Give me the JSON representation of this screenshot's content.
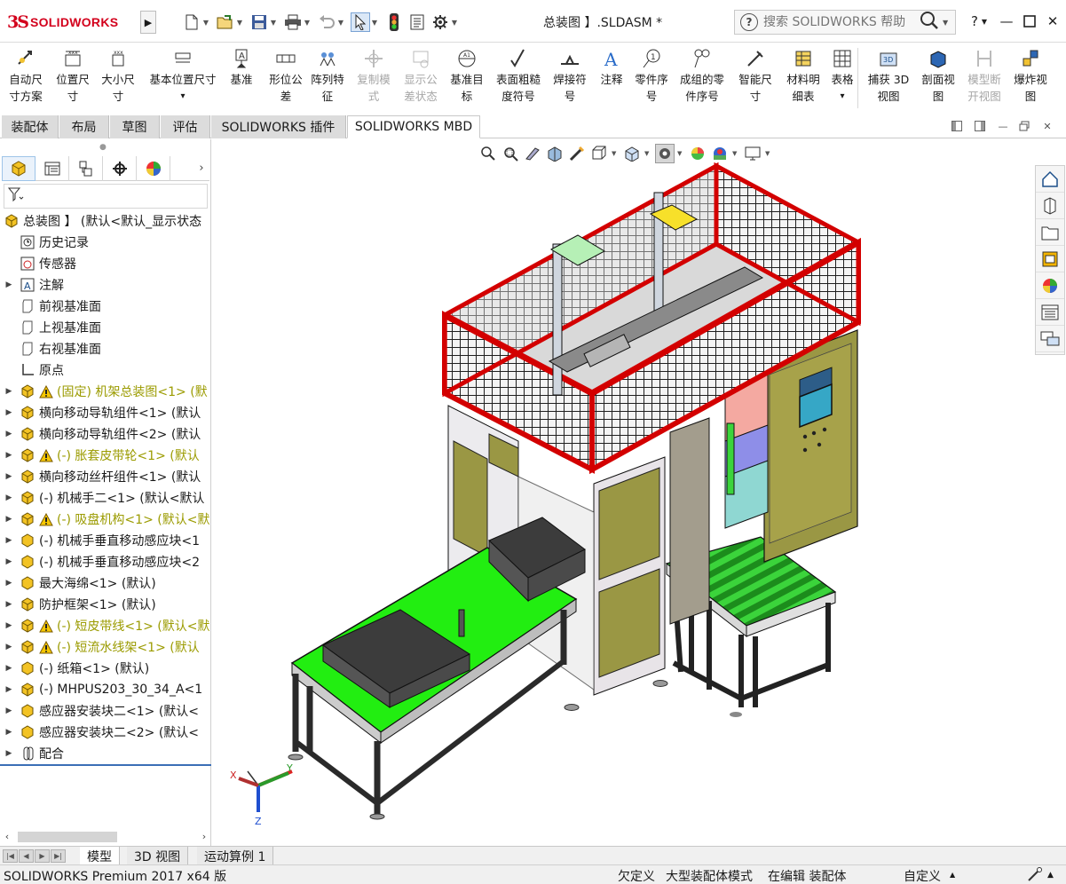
{
  "app": {
    "brand": "SOLIDWORKS",
    "document_title": "总装图 】.SLDASM *",
    "brand_color": "#d3001c"
  },
  "search": {
    "placeholder": "搜索 SOLIDWORKS 帮助"
  },
  "commands": [
    {
      "label": "自动尺\n寸方案",
      "icon": "auto-dimension-icon",
      "disabled": false
    },
    {
      "label": "位置尺\n寸",
      "icon": "location-dimension-icon",
      "disabled": false
    },
    {
      "label": "大小尺\n寸",
      "icon": "size-dimension-icon",
      "disabled": false
    },
    {
      "label": "基本位置尺寸",
      "icon": "basic-location-dimension-icon",
      "disabled": false
    },
    {
      "label": "基准",
      "icon": "datum-icon",
      "disabled": false
    },
    {
      "label": "形位公\n差",
      "icon": "geometric-tolerance-icon",
      "disabled": false
    },
    {
      "label": "阵列特\n征",
      "icon": "pattern-feature-icon",
      "disabled": false
    },
    {
      "label": "复制模\n式",
      "icon": "copy-scheme-icon",
      "disabled": true
    },
    {
      "label": "显示公\n差状态",
      "icon": "tolerance-status-icon",
      "disabled": true
    },
    {
      "label": "基准目\n标",
      "icon": "datum-target-icon",
      "disabled": false
    },
    {
      "label": "表面粗糙\n度符号",
      "icon": "surface-finish-icon",
      "disabled": false
    },
    {
      "label": "焊接符\n号",
      "icon": "weld-symbol-icon",
      "disabled": false
    },
    {
      "label": "注释",
      "icon": "note-icon",
      "disabled": false
    },
    {
      "label": "零件序\n号",
      "icon": "balloon-icon",
      "disabled": false
    },
    {
      "label": "成组的零\n件序号",
      "icon": "stacked-balloon-icon",
      "disabled": false
    },
    {
      "label": "智能尺\n寸",
      "icon": "smart-dimension-icon",
      "disabled": false
    },
    {
      "label": "材料明\n细表",
      "icon": "bom-icon",
      "disabled": false
    },
    {
      "label": "表格",
      "icon": "table-icon",
      "disabled": false
    },
    {
      "label": "捕获 3D\n视图",
      "icon": "capture-3d-view-icon",
      "disabled": false
    },
    {
      "label": "剖面视\n图",
      "icon": "section-view-icon",
      "disabled": false
    },
    {
      "label": "模型断\n开视图",
      "icon": "break-view-icon",
      "disabled": true
    },
    {
      "label": "爆炸视\n图",
      "icon": "exploded-view-icon",
      "disabled": false
    }
  ],
  "command_tabs": [
    "装配体",
    "布局",
    "草图",
    "评估",
    "SOLIDWORKS 插件",
    "SOLIDWORKS MBD"
  ],
  "active_command_tab": "SOLIDWORKS MBD",
  "tree": {
    "root": "总装图 】 (默认<默认_显示状态",
    "items": [
      {
        "label": "历史记录",
        "icon": "history-icon",
        "expandable": false,
        "warning": false
      },
      {
        "label": "传感器",
        "icon": "sensor-icon",
        "expandable": false,
        "warning": false
      },
      {
        "label": "注解",
        "icon": "annotation-icon",
        "expandable": true,
        "warning": false
      },
      {
        "label": "前视基准面",
        "icon": "plane-icon",
        "expandable": false,
        "warning": false
      },
      {
        "label": "上视基准面",
        "icon": "plane-icon",
        "expandable": false,
        "warning": false
      },
      {
        "label": "右视基准面",
        "icon": "plane-icon",
        "expandable": false,
        "warning": false
      },
      {
        "label": "原点",
        "icon": "origin-icon",
        "expandable": false,
        "warning": false
      },
      {
        "label": "(固定) 机架总装图<1> (默",
        "icon": "assembly-icon",
        "expandable": true,
        "warning": true
      },
      {
        "label": "横向移动导轨组件<1> (默认",
        "icon": "assembly-icon",
        "expandable": true,
        "warning": false
      },
      {
        "label": "横向移动导轨组件<2> (默认",
        "icon": "assembly-icon",
        "expandable": true,
        "warning": false
      },
      {
        "label": "(-) 胀套皮带轮<1> (默认",
        "icon": "assembly-icon",
        "expandable": true,
        "warning": true
      },
      {
        "label": "横向移动丝杆组件<1> (默认",
        "icon": "assembly-icon",
        "expandable": true,
        "warning": false
      },
      {
        "label": "(-) 机械手二<1> (默认<默认",
        "icon": "assembly-icon",
        "expandable": true,
        "warning": false
      },
      {
        "label": "(-) 吸盘机构<1> (默认<默",
        "icon": "assembly-icon",
        "expandable": true,
        "warning": true
      },
      {
        "label": "(-) 机械手垂直移动感应块<1",
        "icon": "part-icon",
        "expandable": true,
        "warning": false
      },
      {
        "label": "(-) 机械手垂直移动感应块<2",
        "icon": "part-icon",
        "expandable": true,
        "warning": false
      },
      {
        "label": "最大海绵<1> (默认)",
        "icon": "part-icon",
        "expandable": true,
        "warning": false
      },
      {
        "label": "防护框架<1> (默认)",
        "icon": "assembly-icon",
        "expandable": true,
        "warning": false
      },
      {
        "label": "(-) 短皮带线<1> (默认<默",
        "icon": "assembly-icon",
        "expandable": true,
        "warning": true
      },
      {
        "label": "(-) 短流水线架<1> (默认",
        "icon": "assembly-icon",
        "expandable": true,
        "warning": true
      },
      {
        "label": "(-) 纸箱<1> (默认)",
        "icon": "part-icon",
        "expandable": true,
        "warning": false
      },
      {
        "label": "(-) MHPUS203_30_34_A<1",
        "icon": "assembly-icon",
        "expandable": true,
        "warning": false
      },
      {
        "label": "感应器安装块二<1> (默认<",
        "icon": "part-icon",
        "expandable": true,
        "warning": false
      },
      {
        "label": "感应器安装块二<2> (默认<",
        "icon": "part-icon",
        "expandable": true,
        "warning": false
      },
      {
        "label": "配合",
        "icon": "mates-icon",
        "expandable": true,
        "warning": false
      }
    ]
  },
  "bottom_tabs": [
    "模型",
    "3D 视图",
    "运动算例 1"
  ],
  "active_bottom_tab": "模型",
  "status": {
    "product": "SOLIDWORKS Premium 2017 x64 版",
    "constraint": "欠定义",
    "mode": "大型装配体模式",
    "editing": "在编辑 装配体",
    "units": "自定义"
  },
  "triad": {
    "x": "X",
    "y": "Y",
    "z": "Z"
  }
}
